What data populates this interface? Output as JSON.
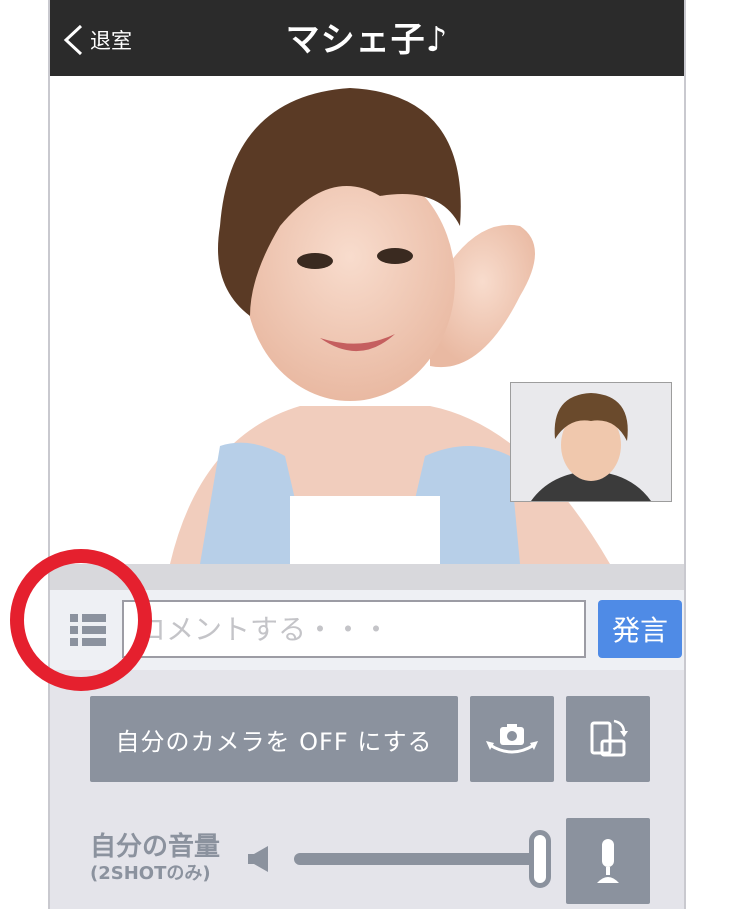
{
  "header": {
    "back_label": "退室",
    "title": "マシェ子♪"
  },
  "comment": {
    "placeholder": "コメントする・・・",
    "send_label": "発言"
  },
  "controls": {
    "camera_off_label": "自分のカメラを OFF にする"
  },
  "volume": {
    "label": "自分の音量",
    "sublabel": "(2SHOTのみ)",
    "level": 1.0
  },
  "icons": {
    "back": "chevron-left-icon",
    "list": "list-icon",
    "camera_switch": "camera-switch-icon",
    "rotate": "rotate-screen-icon",
    "speaker": "speaker-icon",
    "mic": "microphone-icon"
  },
  "colors": {
    "header_bg": "#2b2b2b",
    "send_button": "#4f8be6",
    "control_button": "#8b929e",
    "highlight_ring": "#e5202e"
  }
}
